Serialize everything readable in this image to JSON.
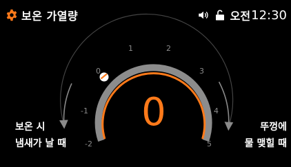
{
  "header": {
    "title": "보온 가열량",
    "settings_icon": "gear-icon",
    "accent_color": "#ff7a1a"
  },
  "status_bar": {
    "sound_icon": "speaker-icon",
    "lock_icon": "unlock-icon",
    "ampm": "오전",
    "time": "12:30"
  },
  "dial": {
    "current_value": "0",
    "min": -2,
    "max": 5,
    "ticks": [
      "-2",
      "-1",
      "0",
      "1",
      "2",
      "3",
      "4",
      "5"
    ]
  },
  "labels": {
    "left_line1": "보온 시",
    "left_line2": "냄새가 날 때",
    "right_line1": "뚜껑에",
    "right_line2": "물 맺힐 때"
  }
}
